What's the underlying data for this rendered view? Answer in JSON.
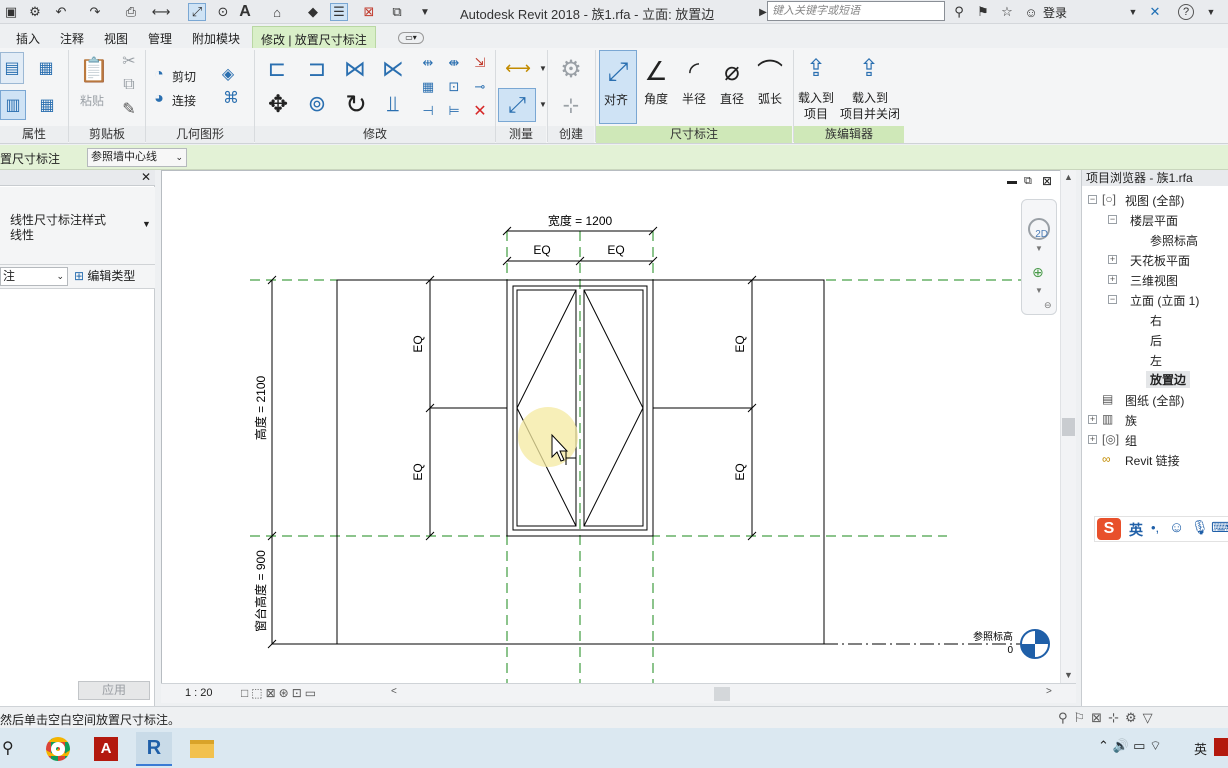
{
  "window": {
    "title": "Autodesk Revit 2018 -    族1.rfa - 立面: 放置边",
    "search_placeholder": "键入关键字或短语",
    "login": "登录"
  },
  "menu_tabs": [
    "插入",
    "注释",
    "视图",
    "管理",
    "附加模块",
    "修改 | 放置尺寸标注"
  ],
  "ribbon": {
    "panels": {
      "properties": "属性",
      "clipboard": "剪贴板",
      "geometry": "几何图形",
      "modify": "修改",
      "measure": "测量",
      "create": "创建",
      "dimension": "尺寸标注",
      "family_editor": "族编辑器"
    },
    "paste": "粘贴",
    "cut": "剪切",
    "join": "连接",
    "dim_tools": [
      "对齐",
      "角度",
      "半径",
      "直径",
      "弧长"
    ],
    "load_into_project": [
      "载入到",
      "项目"
    ],
    "load_and_close": [
      "载入到",
      "项目并关闭"
    ]
  },
  "options_bar": {
    "label": "置尺寸标注",
    "placement": "参照墙中心线"
  },
  "properties": {
    "type_line1": "线性尺寸标注样式",
    "type_line2": "线性",
    "filter": "注",
    "edit_type": "编辑类型",
    "apply": "应用"
  },
  "drawing": {
    "width_dim": "宽度 = 1200",
    "eq": "EQ",
    "height_dim": "高度 = 2100",
    "sill_dim": "窗台高度 = 900",
    "ref_level": "参照标高",
    "ref_level_value": "0"
  },
  "view_control": {
    "scale": "1 : 20"
  },
  "project_browser": {
    "title": "项目浏览器 - 族1.rfa",
    "items": [
      {
        "label": "视图 (全部)"
      },
      {
        "label": "楼层平面"
      },
      {
        "label": "参照标高"
      },
      {
        "label": "天花板平面"
      },
      {
        "label": "三维视图"
      },
      {
        "label": "立面 (立面 1)"
      },
      {
        "label": "右"
      },
      {
        "label": "后"
      },
      {
        "label": "左"
      },
      {
        "label": "放置边"
      },
      {
        "label": "图纸 (全部)"
      },
      {
        "label": "族"
      },
      {
        "label": "组"
      },
      {
        "label": "Revit 链接"
      }
    ]
  },
  "ime": {
    "label": "英"
  },
  "status": {
    "message": "然后单击空白空间放置尺寸标注。"
  },
  "tray": {
    "lang": "英"
  }
}
